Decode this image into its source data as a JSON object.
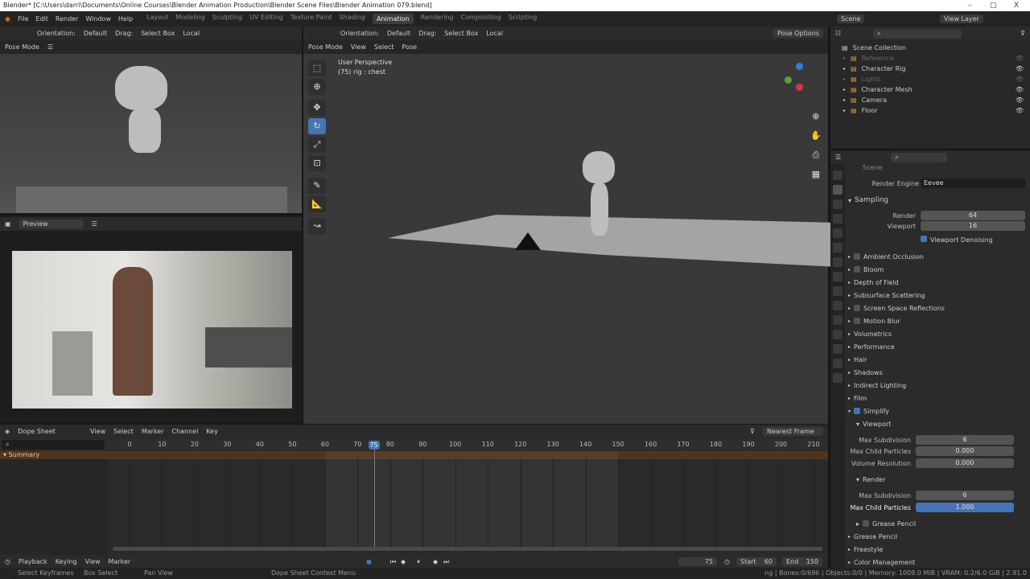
{
  "window": {
    "title": "Blender* [C:\\Users\\darri\\Documents\\Online Courses\\Blender Animation Production\\Blender Scene Files\\Blender Animation 079.blend]",
    "minimize": "–",
    "maximize": "▢",
    "close": "X"
  },
  "menu": [
    "File",
    "Edit",
    "Render",
    "Window",
    "Help"
  ],
  "workspaces": [
    "Layout",
    "Modeling",
    "Sculpting",
    "UV Editing",
    "Texture Paint",
    "Shading",
    "Animation",
    "Rendering",
    "Compositing",
    "Scripting"
  ],
  "active_workspace": "Animation",
  "scene": "Scene",
  "view_layer": "View Layer",
  "left_viewport": {
    "orientation_label": "Orientation:",
    "orientation": "Default",
    "drag_label": "Drag:",
    "drag": "Select Box",
    "pivot": "Local",
    "mode": "Pose Mode"
  },
  "image_editor": {
    "mode": "Preview"
  },
  "main_viewport": {
    "orientation_label": "Orientation:",
    "orientation": "Default",
    "drag_label": "Drag:",
    "drag": "Select Box",
    "pivot": "Local",
    "mode": "Pose Mode",
    "menus": [
      "View",
      "Select",
      "Pose"
    ],
    "pose_options": "Pose Options",
    "overlay_title": "User Perspective",
    "overlay_sub": "(75) rig : chest"
  },
  "outliner": {
    "root": "Scene Collection",
    "items": [
      {
        "name": "Reference",
        "dim": true
      },
      {
        "name": "Character Rig"
      },
      {
        "name": "Lights",
        "dim": true
      },
      {
        "name": "Character Mesh"
      },
      {
        "name": "Camera"
      },
      {
        "name": "Floor"
      }
    ]
  },
  "properties": {
    "scene_label": "Scene",
    "render_engine_label": "Render Engine",
    "render_engine": "Eevee",
    "sampling": "Sampling",
    "render_label": "Render",
    "render_samples": "64",
    "viewport_label": "Viewport",
    "viewport_samples": "16",
    "viewport_denoising": "Viewport Denoising",
    "panels": [
      "Ambient Occlusion",
      "Bloom",
      "Depth of Field",
      "Subsurface Scattering",
      "Screen Space Reflections",
      "Motion Blur",
      "Volumetrics",
      "Performance",
      "Hair",
      "Shadows",
      "Indirect Lighting",
      "Film",
      "Simplify"
    ],
    "simplify": {
      "viewport": "Viewport",
      "max_subdivision_label": "Max Subdivision",
      "max_subdivision": "6",
      "max_child_particles_label": "Max Child Particles",
      "max_child_particles": "0.000",
      "volume_resolution_label": "Volume Resolution",
      "volume_resolution": "0.000",
      "render": "Render",
      "render_max_subdivision": "6",
      "render_max_child_particles": "1.000",
      "grease_pencil": "Grease Pencil"
    },
    "after": [
      "Grease Pencil",
      "Freestyle",
      "Color Management"
    ]
  },
  "dopesheet": {
    "mode": "Dope Sheet",
    "menus": [
      "View",
      "Select",
      "Marker",
      "Channel",
      "Key"
    ],
    "snap": "Nearest Frame",
    "summary": "Summary",
    "ticks": [
      0,
      10,
      20,
      30,
      40,
      50,
      60,
      70,
      80,
      90,
      100,
      110,
      120,
      130,
      140,
      150,
      160,
      170,
      180,
      190,
      200,
      210
    ],
    "current_frame": 75,
    "keyframe_range": [
      60,
      150
    ]
  },
  "timeline": {
    "menus": [
      "Playback",
      "Keying",
      "View",
      "Marker"
    ],
    "frame": "75",
    "start_label": "Start",
    "start": "60",
    "end_label": "End",
    "end": "150"
  },
  "status": {
    "left": [
      "Select Keyframes",
      "Box Select",
      "Pan View",
      "Dope Sheet Context Menu"
    ],
    "right": "ng | Bones:0/696 | Objects:0/0 | Memory: 1009.0 MiB | VRAM: 0.2/6.0 GiB | 2.91.0"
  },
  "colors": {
    "accent": "#4772b3",
    "summary": "#51331e",
    "active_ws": "#3d3d3d"
  }
}
